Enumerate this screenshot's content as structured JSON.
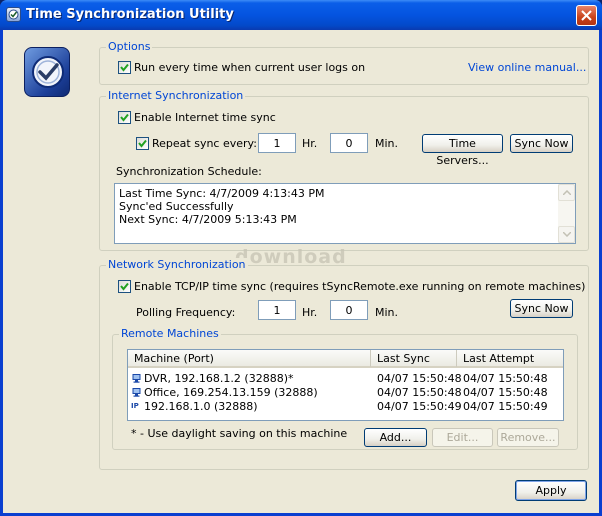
{
  "window": {
    "title": "Time Synchronization Utility"
  },
  "options": {
    "legend": "Options",
    "run_on_login": {
      "label": "Run every time when current user logs on",
      "checked": true
    },
    "manual_link": "View online manual..."
  },
  "internet": {
    "legend": "Internet Synchronization",
    "enable": {
      "label": "Enable Internet time sync",
      "checked": true
    },
    "repeat": {
      "label": "Repeat sync every:",
      "checked": true
    },
    "hours_value": "1",
    "hours_unit": "Hr.",
    "minutes_value": "0",
    "minutes_unit": "Min.",
    "time_servers_button": "Time Servers...",
    "sync_now_button": "Sync Now",
    "schedule_label": "Synchronization Schedule:",
    "log": [
      "Last Time Sync: 4/7/2009 4:13:43 PM",
      "Sync'ed Successfully",
      "Next Sync: 4/7/2009 5:13:43 PM"
    ]
  },
  "network": {
    "legend": "Network Synchronization",
    "enable": {
      "label": "Enable TCP/IP time sync (requires tSyncRemote.exe running on remote machines)",
      "checked": true
    },
    "polling_label": "Polling Frequency:",
    "hours_value": "1",
    "hours_unit": "Hr.",
    "minutes_value": "0",
    "minutes_unit": "Min.",
    "sync_now_button": "Sync Now",
    "remote": {
      "legend": "Remote Machines",
      "columns": [
        "Machine (Port)",
        "Last Sync",
        "Last Attempt"
      ],
      "rows": [
        {
          "icon": "computer-icon",
          "machine": "DVR, 192.168.1.2 (32888)*",
          "last_sync": "04/07 15:50:48",
          "last_attempt": "04/07 15:50:48"
        },
        {
          "icon": "computer-icon",
          "machine": "Office, 169.254.13.159 (32888)",
          "last_sync": "04/07 15:50:48",
          "last_attempt": "04/07 15:50:48"
        },
        {
          "icon": "ip-icon",
          "machine": "192.168.1.0 (32888)",
          "last_sync": "04/07 15:50:49",
          "last_attempt": "04/07 15:50:49"
        }
      ],
      "footnote": "* - Use daylight saving on this machine",
      "add_button": "Add...",
      "edit_button": "Edit...",
      "remove_button": "Remove..."
    }
  },
  "apply_button": "Apply",
  "watermark": "download"
}
